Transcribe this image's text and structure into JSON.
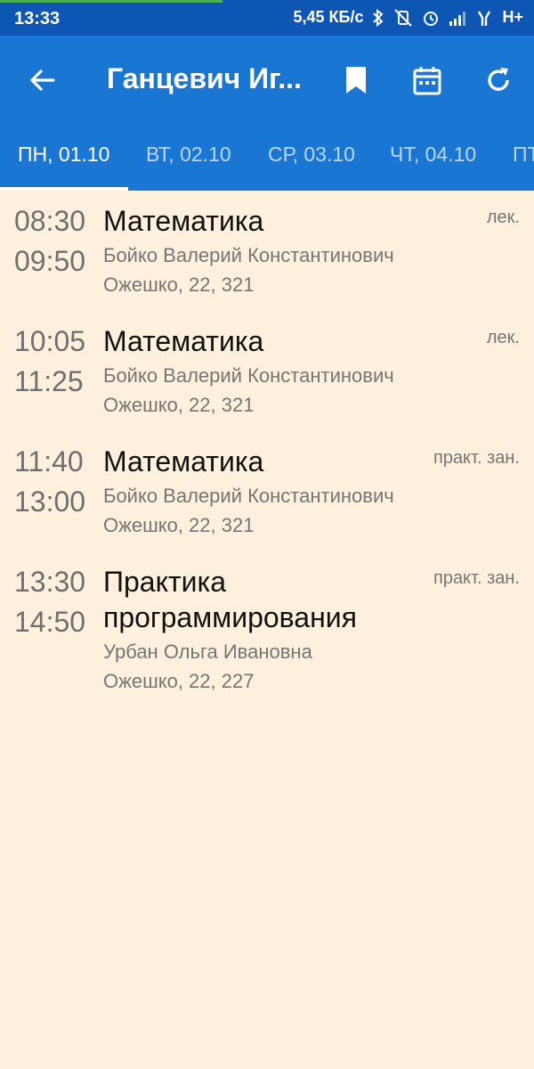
{
  "status_bar": {
    "time": "13:33",
    "net_speed": "5,45 КБ/с",
    "network": "H+",
    "icons": [
      "bluetooth-icon",
      "vibrate-off-icon",
      "alarm-icon",
      "signal-icon",
      "signal-icon",
      "network-type"
    ]
  },
  "app_bar": {
    "title": "Ганцевич Иг...",
    "back_icon": "arrow-back-icon",
    "actions": [
      "bookmark-icon",
      "calendar-icon",
      "refresh-icon"
    ]
  },
  "tabs": [
    "ПН, 01.10",
    "ВТ, 02.10",
    "СР, 03.10",
    "ЧТ, 04.10",
    "ПТ"
  ],
  "active_tab": 0,
  "lessons": [
    {
      "start": "08:30",
      "end": "09:50",
      "subject": "Математика",
      "teacher": "Бойко Валерий Константинович",
      "room": "Ожешко, 22, 321",
      "type": "лек."
    },
    {
      "start": "10:05",
      "end": "11:25",
      "subject": "Математика",
      "teacher": "Бойко Валерий Константинович",
      "room": "Ожешко, 22, 321",
      "type": "лек."
    },
    {
      "start": "11:40",
      "end": "13:00",
      "subject": "Математика",
      "teacher": "Бойко Валерий Константинович",
      "room": "Ожешко, 22, 321",
      "type": "практ. зан."
    },
    {
      "start": "13:30",
      "end": "14:50",
      "subject": "Практика программирования",
      "teacher": "Урбан Ольга Ивановна",
      "room": "Ожешко, 22, 227",
      "type": "практ. зан."
    }
  ],
  "colors": {
    "primary": "#1976d2",
    "status_bar": "#0e56b4",
    "background": "#fdf1de"
  }
}
